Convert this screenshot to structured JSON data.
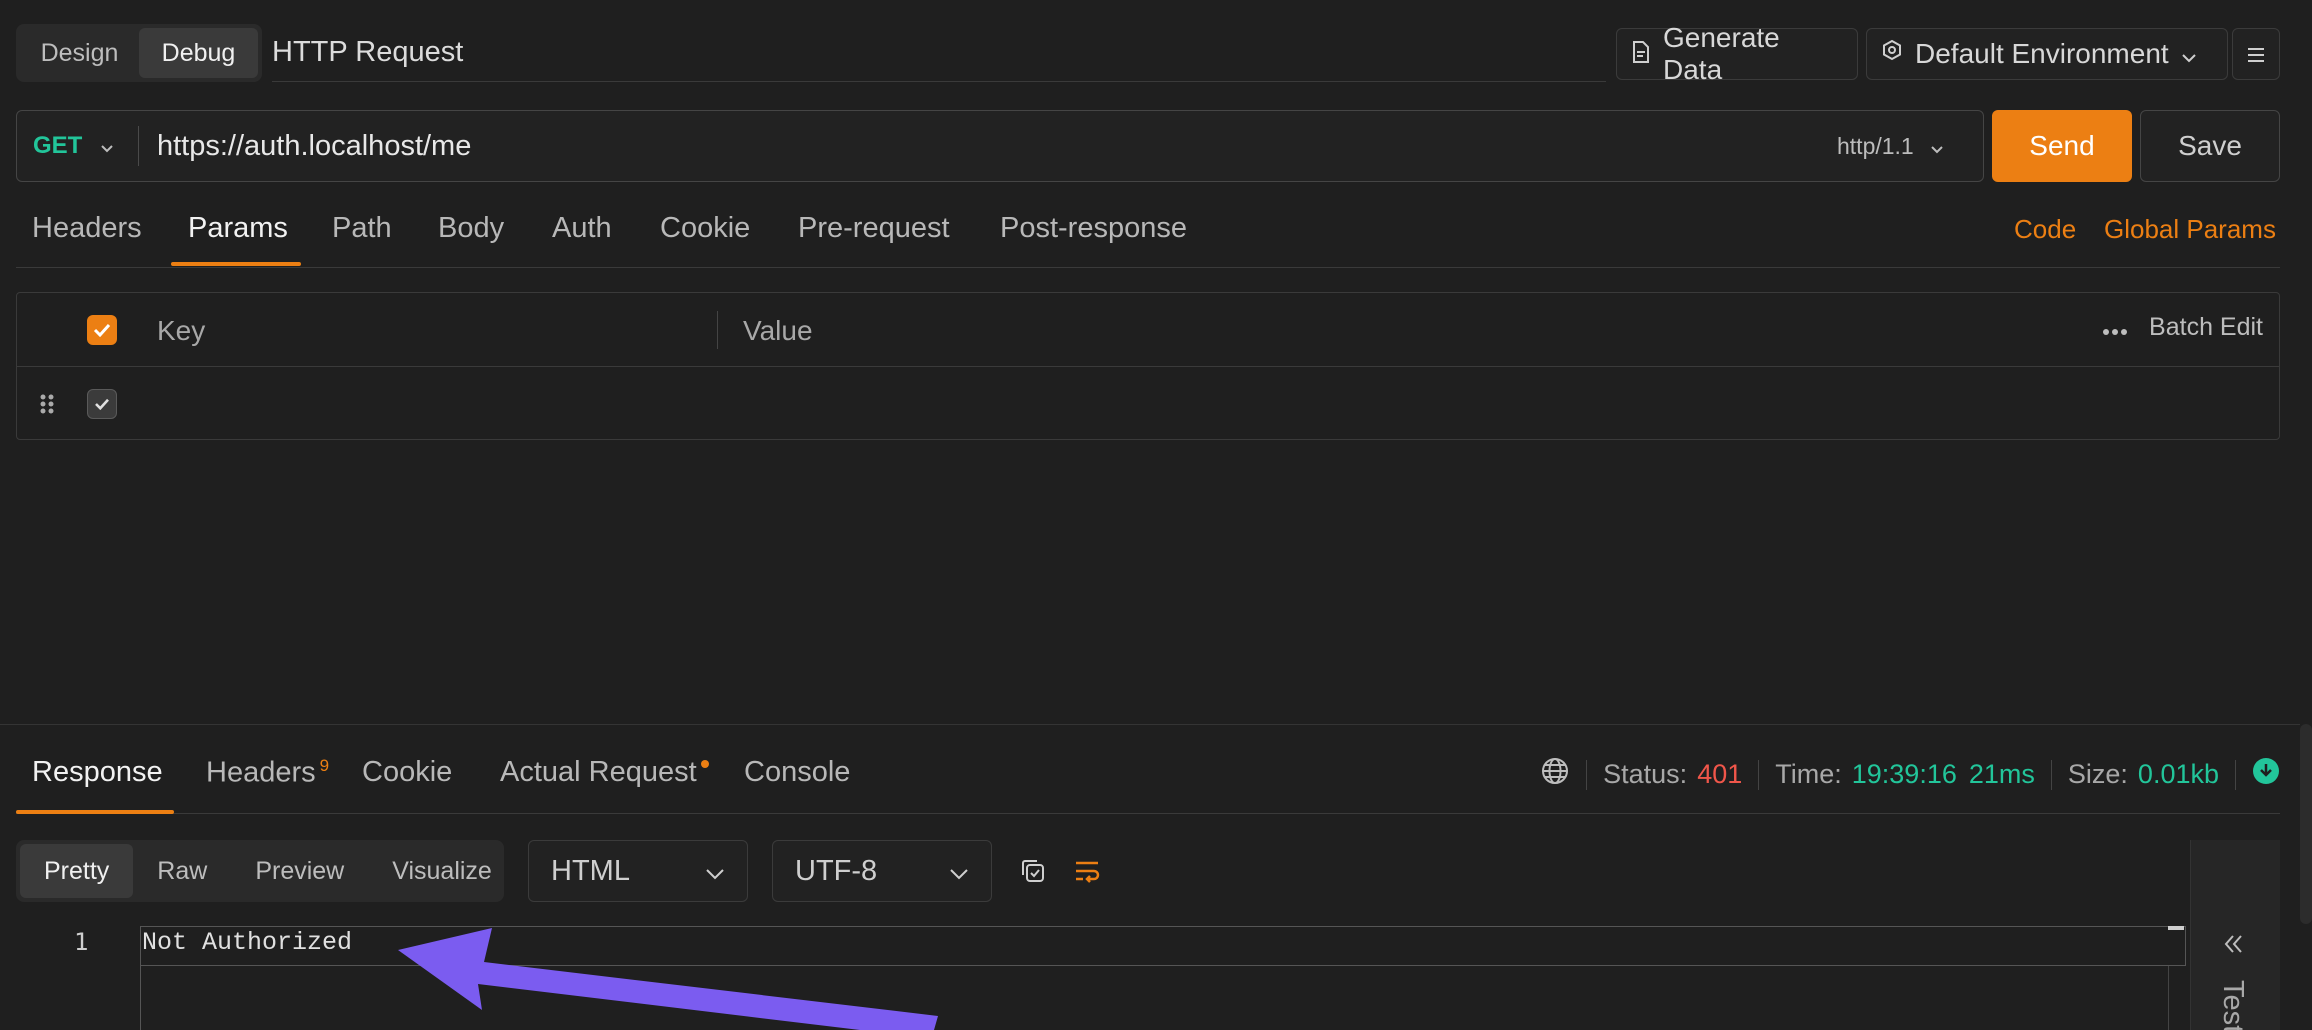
{
  "modes": {
    "design": "Design",
    "debug": "Debug"
  },
  "request": {
    "title": "HTTP Request",
    "method": "GET",
    "url": "https://auth.localhost/me",
    "protocol": "http/1.1",
    "send": "Send",
    "save": "Save"
  },
  "toolbar": {
    "generate_data": "Generate Data",
    "environment": "Default Environment"
  },
  "request_tabs": [
    "Headers",
    "Params",
    "Path",
    "Body",
    "Auth",
    "Cookie",
    "Pre-request",
    "Post-response"
  ],
  "request_links": {
    "code": "Code",
    "global_params": "Global Params"
  },
  "params_table": {
    "key_header": "Key",
    "value_header": "Value",
    "batch_edit": "Batch Edit"
  },
  "response_tabs": {
    "response": "Response",
    "headers": "Headers",
    "headers_count": "9",
    "cookie": "Cookie",
    "actual_request": "Actual Request",
    "console": "Console"
  },
  "status": {
    "status_label": "Status:",
    "status_value": "401",
    "time_label": "Time:",
    "time_clock": "19:39:16",
    "time_ms": "21ms",
    "size_label": "Size:",
    "size_value": "0.01kb"
  },
  "format_tabs": [
    "Pretty",
    "Raw",
    "Preview",
    "Visualize"
  ],
  "selects": {
    "type": "HTML",
    "encoding": "UTF-8"
  },
  "code": {
    "line_number": "1",
    "text": "Not Authorized"
  },
  "side_panel": {
    "label": "Test"
  },
  "colors": {
    "accent": "#ec7f13",
    "method": "#22c59a",
    "status_error": "#f0564a",
    "annotation": "#7b5cf0"
  }
}
